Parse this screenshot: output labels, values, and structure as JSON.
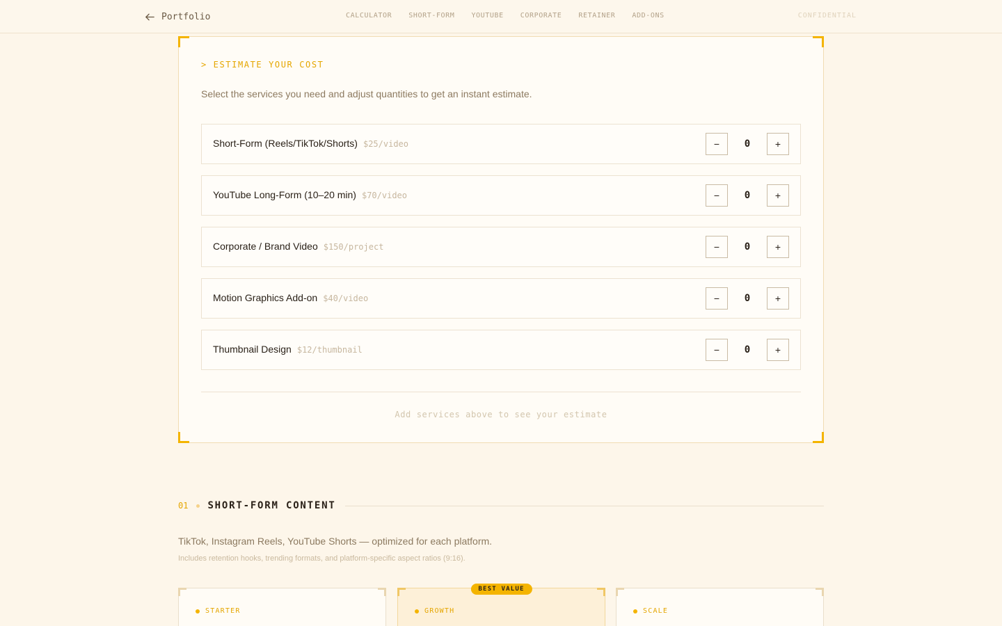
{
  "nav": {
    "back_label": "Portfolio",
    "links": [
      "CALCULATOR",
      "SHORT-FORM",
      "YOUTUBE",
      "CORPORATE",
      "RETAINER",
      "ADD-ONS"
    ],
    "confidential": "CONFIDENTIAL"
  },
  "calculator": {
    "eyebrow": "> ESTIMATE YOUR COST",
    "description": "Select the services you need and adjust quantities to get an instant estimate.",
    "services": [
      {
        "name": "Short-Form (Reels/TikTok/Shorts)",
        "rate": "$25/video",
        "qty": "0"
      },
      {
        "name": "YouTube Long-Form (10–20 min)",
        "rate": "$70/video",
        "qty": "0"
      },
      {
        "name": "Corporate / Brand Video",
        "rate": "$150/project",
        "qty": "0"
      },
      {
        "name": "Motion Graphics Add-on",
        "rate": "$40/video",
        "qty": "0"
      },
      {
        "name": "Thumbnail Design",
        "rate": "$12/thumbnail",
        "qty": "0"
      }
    ],
    "decrement_label": "−",
    "increment_label": "+",
    "empty_message": "Add services above to see your estimate"
  },
  "section": {
    "number": "01",
    "title": "SHORT-FORM CONTENT",
    "description": "TikTok, Instagram Reels, YouTube Shorts — optimized for each platform.",
    "note": "Includes retention hooks, trending formats, and platform-specific aspect ratios (9:16).",
    "tiers": [
      {
        "name": "STARTER"
      },
      {
        "name": "GROWTH",
        "badge": "BEST VALUE"
      },
      {
        "name": "SCALE"
      }
    ]
  },
  "colors": {
    "accent": "#f4b400",
    "background": "#fdf6ea",
    "text": "#2a2118"
  },
  "icons": {
    "back": "arrow-left-icon"
  }
}
